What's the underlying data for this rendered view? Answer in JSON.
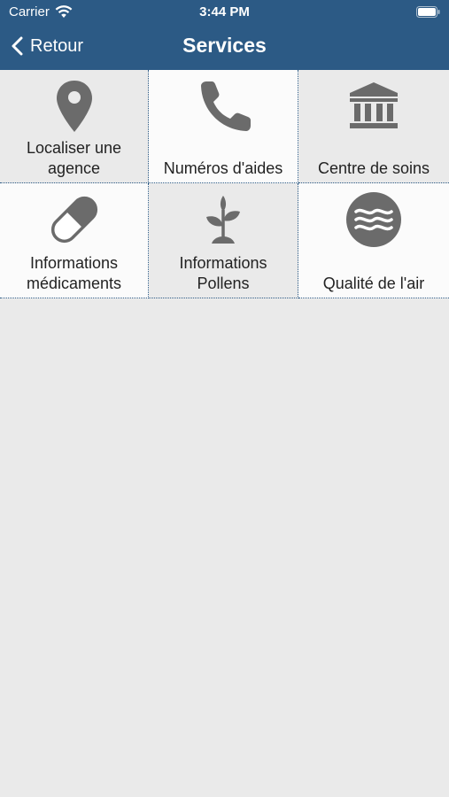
{
  "status": {
    "carrier": "Carrier",
    "time": "3:44 PM"
  },
  "nav": {
    "back_label": "Retour",
    "title": "Services"
  },
  "tiles": [
    {
      "label": "Localiser une agence",
      "icon": "location-pin-icon"
    },
    {
      "label": "Numéros d'aides",
      "icon": "phone-icon"
    },
    {
      "label": "Centre de soins",
      "icon": "bank-building-icon"
    },
    {
      "label": "Informations médicaments",
      "icon": "pill-capsule-icon"
    },
    {
      "label": "Informations Pollens",
      "icon": "plant-sprout-icon"
    },
    {
      "label": "Qualité de l'air",
      "icon": "air-waves-icon"
    }
  ],
  "colors": {
    "nav_bar": "#2c5a85",
    "icon": "#6b6b6b",
    "background": "#eaeaea"
  }
}
